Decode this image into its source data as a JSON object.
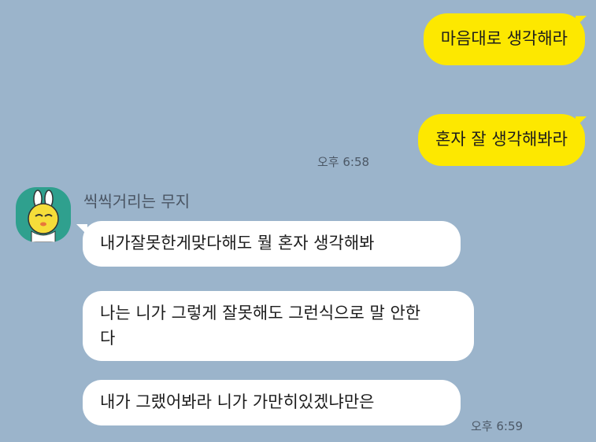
{
  "chat": {
    "my_messages": [
      {
        "text": "마음대로 생각해라"
      },
      {
        "text": "혼자 잘 생각해봐라",
        "time": "오후 6:58"
      }
    ],
    "sender": {
      "name": "씩씩거리는 무지",
      "avatar_icon": "muzi-character-icon"
    },
    "their_messages": [
      {
        "text": "내가잘못한게맞다해도 뭘 혼자 생각해봐"
      },
      {
        "text": "나는 니가 그렇게 잘못해도 그런식으로 말 안한다"
      },
      {
        "text": "내가 그랬어봐라 니가 가만히있겠냐만은",
        "time": "오후 6:59"
      }
    ]
  },
  "colors": {
    "background": "#9bb4cb",
    "my_bubble": "#fde800",
    "their_bubble": "#ffffff",
    "avatar_bg": "#2fa08e"
  }
}
